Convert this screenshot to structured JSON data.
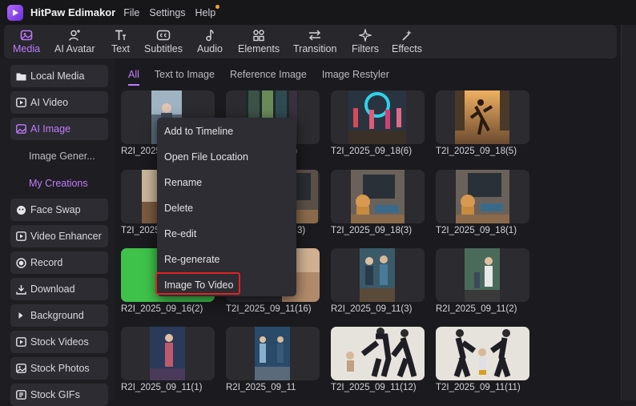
{
  "app": {
    "title": "HitPaw Edimakor",
    "menu": [
      "File",
      "Settings",
      "Help"
    ]
  },
  "toolbar": {
    "tools": [
      {
        "label": "Media",
        "icon": "media-icon"
      },
      {
        "label": "AI Avatar",
        "icon": "ai-avatar-icon"
      },
      {
        "label": "Text",
        "icon": "text-icon"
      },
      {
        "label": "Subtitles",
        "icon": "subtitles-icon"
      },
      {
        "label": "Audio",
        "icon": "audio-icon"
      },
      {
        "label": "Elements",
        "icon": "elements-icon"
      },
      {
        "label": "Transition",
        "icon": "transition-icon"
      },
      {
        "label": "Filters",
        "icon": "filters-icon"
      },
      {
        "label": "Effects",
        "icon": "effects-icon"
      }
    ]
  },
  "sidebar": {
    "items": [
      {
        "label": "Local Media"
      },
      {
        "label": "AI Video"
      },
      {
        "label": "AI Image"
      },
      {
        "label": "Image Gener..."
      },
      {
        "label": "My Creations"
      },
      {
        "label": "Face Swap"
      },
      {
        "label": "Video Enhancer"
      },
      {
        "label": "Record"
      },
      {
        "label": "Download"
      },
      {
        "label": "Background"
      },
      {
        "label": "Stock Videos"
      },
      {
        "label": "Stock Photos"
      },
      {
        "label": "Stock GIFs"
      }
    ]
  },
  "tabs": [
    "All",
    "Text to Image",
    "Reference Image",
    "Image Restyler"
  ],
  "grid": {
    "captions": [
      "R2I_2025",
      "",
      "T2I_2025_09_18(6)",
      "T2I_2025_09_18(5)",
      "T2I_2025",
      "",
      "T2I_2025_09_18(3)",
      "T2I_2025_09_18(1)",
      "R2I_2025_09_16(2)",
      "T2I_2025_09_11(16)",
      "R2I_2025_09_11(3)",
      "R2I_2025_09_11(2)",
      "R2I_2025_09_11(1)",
      "R2I_2025_09_11",
      "T2I_2025_09_11(12)",
      "T2I_2025_09_11(11)"
    ],
    "partial_captions": [
      "7)",
      "3)"
    ]
  },
  "context_menu": {
    "items": [
      "Add to Timeline",
      "Open File Location",
      "Rename",
      "Delete",
      "Re-edit",
      "Re-generate",
      "Image To Video"
    ],
    "highlighted": "Image To Video"
  },
  "colors": {
    "accent": "#c07bff",
    "highlight_border": "#e02424"
  }
}
